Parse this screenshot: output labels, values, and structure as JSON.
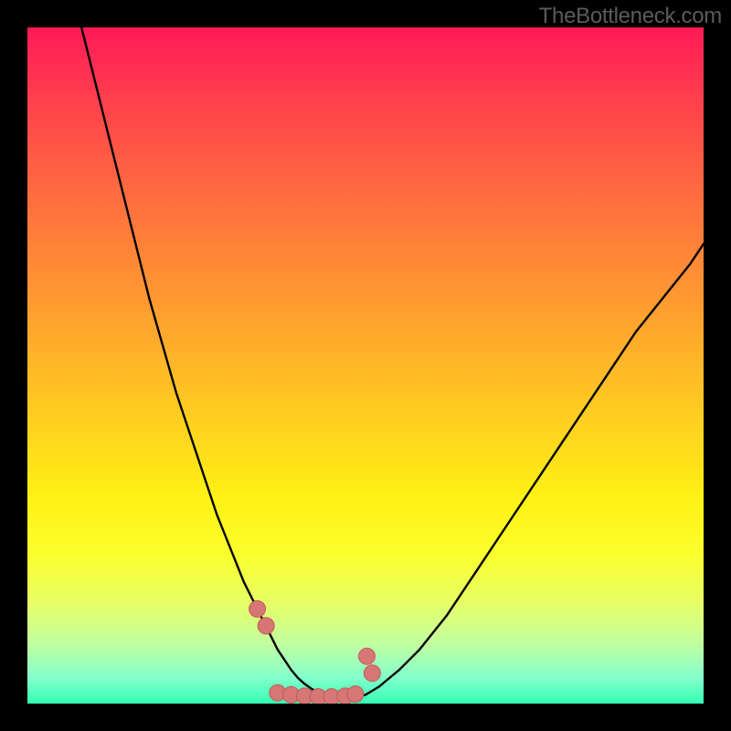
{
  "watermark": {
    "text": "TheBottleneck.com"
  },
  "chart_data": {
    "type": "line",
    "title": "",
    "xlabel": "",
    "ylabel": "",
    "xlim": [
      0,
      100
    ],
    "ylim": [
      0,
      100
    ],
    "series": [
      {
        "name": "left-curve",
        "x": [
          8,
          10,
          12,
          14,
          16,
          18,
          20,
          22,
          24,
          26,
          28,
          30,
          32,
          34,
          35,
          36,
          37,
          38,
          39,
          40,
          41,
          42,
          43,
          44
        ],
        "values": [
          100,
          92,
          84,
          76,
          68,
          60,
          53,
          46,
          40,
          34,
          28,
          23,
          18,
          14,
          12,
          10,
          8,
          6.5,
          5,
          3.8,
          2.9,
          2.2,
          1.6,
          1.2
        ]
      },
      {
        "name": "floor-segment",
        "x": [
          44,
          45,
          46,
          47,
          48,
          49,
          50
        ],
        "values": [
          1.2,
          1.0,
          0.9,
          0.9,
          1.0,
          1.1,
          1.3
        ]
      },
      {
        "name": "right-curve",
        "x": [
          50,
          52,
          55,
          58,
          62,
          66,
          70,
          74,
          78,
          82,
          86,
          90,
          94,
          98,
          100
        ],
        "values": [
          1.3,
          2.5,
          5,
          8,
          13,
          19,
          25,
          31,
          37,
          43,
          49,
          55,
          60,
          65,
          68
        ]
      }
    ],
    "markers": [
      {
        "name": "left-upper-dot",
        "x": 34.0,
        "y": 14.0
      },
      {
        "name": "left-lower-dot",
        "x": 35.3,
        "y": 11.5
      },
      {
        "name": "right-upper-dot",
        "x": 50.2,
        "y": 7.0
      },
      {
        "name": "right-lower-dot",
        "x": 51.0,
        "y": 4.5
      },
      {
        "name": "floor-1",
        "x": 37.0,
        "y": 1.6
      },
      {
        "name": "floor-2",
        "x": 39.0,
        "y": 1.3
      },
      {
        "name": "floor-3",
        "x": 41.0,
        "y": 1.1
      },
      {
        "name": "floor-4",
        "x": 43.0,
        "y": 1.0
      },
      {
        "name": "floor-5",
        "x": 45.0,
        "y": 1.0
      },
      {
        "name": "floor-6",
        "x": 47.0,
        "y": 1.1
      },
      {
        "name": "floor-7",
        "x": 48.5,
        "y": 1.4
      }
    ],
    "colors": {
      "curve": "#000000",
      "marker_fill": "#d67675",
      "marker_stroke": "#c45a59",
      "background_top": "#ff1a57",
      "background_bottom": "#34ffb4"
    }
  }
}
